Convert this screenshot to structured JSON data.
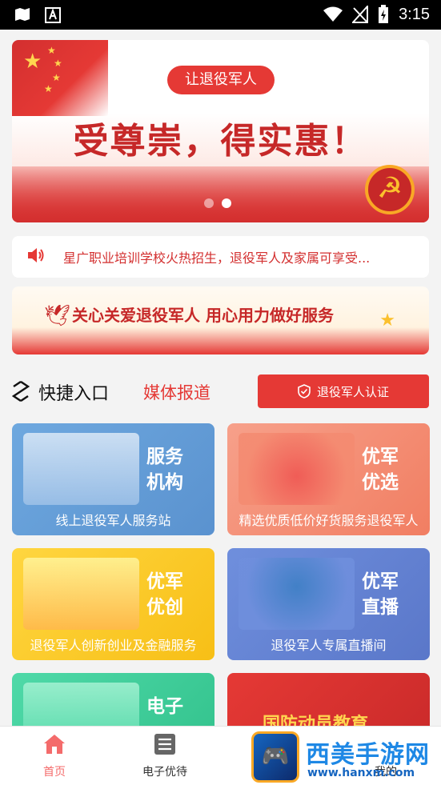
{
  "status_bar": {
    "time": "3:15"
  },
  "banner": {
    "pill": "让退役军人",
    "slogan": "受尊崇，得实惠！",
    "slide_count": 2,
    "active_slide": 2
  },
  "notice": {
    "icon": "speaker-icon",
    "text": "星广职业培训学校火热招生，退役军人及家属可享受..."
  },
  "slogan_banner": {
    "text": "关心关爱退役军人 用心用力做好服务"
  },
  "quick_entry": {
    "title": "快捷入口",
    "media_link": "媒体报道",
    "cert_button": "退役军人认证"
  },
  "cards": [
    {
      "title": "服务机构",
      "desc": "线上退役军人服务站",
      "color": "#6ea8df"
    },
    {
      "title": "优军优选",
      "desc": "精选优质低价好货服务退役军人",
      "color": "#f7a08a"
    },
    {
      "title": "优军优创",
      "desc": "退役军人创新创业及金融服务",
      "color": "#ffd640"
    },
    {
      "title": "优军直播",
      "desc": "退役军人专属直播间",
      "color": "#6f8fdd"
    },
    {
      "title": "电子",
      "desc": "",
      "color": "#4fd9a8"
    },
    {
      "title": "国防动员教育",
      "desc": "",
      "color": "#e53935"
    }
  ],
  "tabbar": {
    "items": [
      {
        "label": "首页",
        "icon": "home-icon",
        "active": true
      },
      {
        "label": "电子优待",
        "icon": "list-icon",
        "active": false
      },
      {
        "label": "",
        "icon": "",
        "active": false
      },
      {
        "label": "我的",
        "icon": "user-icon",
        "active": false
      }
    ]
  },
  "watermark": {
    "title": "西美手游网",
    "url": "www.hanxm.com"
  },
  "colors": {
    "accent": "#e53935",
    "tab_active": "#f46b6b"
  }
}
